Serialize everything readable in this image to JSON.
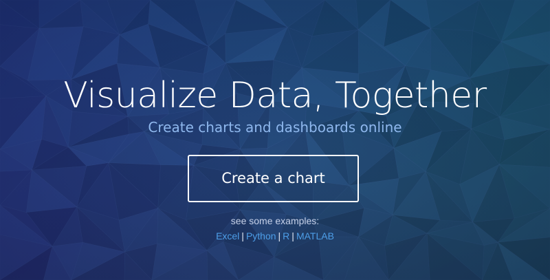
{
  "hero": {
    "title": "Visualize Data, Together",
    "subtitle": "Create charts and dashboards online",
    "cta_label": "Create a chart",
    "examples_label": "see some examples:",
    "examples": [
      {
        "label": "Excel"
      },
      {
        "label": "Python"
      },
      {
        "label": "R"
      },
      {
        "label": "MATLAB"
      }
    ],
    "separator": "|"
  },
  "colors": {
    "background_dark": "#1f2f6e",
    "background_teal": "#2e6e8a",
    "subtitle": "#8fb8ee",
    "link": "#4d9ee8",
    "text": "#ffffff"
  }
}
